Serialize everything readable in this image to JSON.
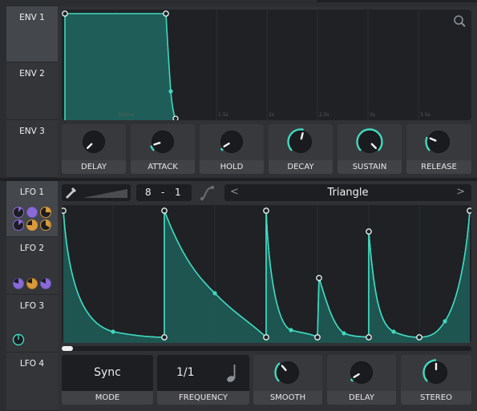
{
  "env_tabs": [
    "ENV 1",
    "ENV 2",
    "ENV 3"
  ],
  "lfo_tabs": [
    "LFO 1",
    "LFO 2",
    "LFO 3",
    "LFO 4"
  ],
  "env": {
    "time_ticks": [
      "500ms",
      "1.5s",
      "2s",
      "2.5s",
      "3s",
      "3.5s"
    ],
    "knobs": [
      {
        "label": "DELAY",
        "value": 0.0
      },
      {
        "label": "ATTACK",
        "value": 0.1
      },
      {
        "label": "HOLD",
        "value": 0.05
      },
      {
        "label": "DECAY",
        "value": 0.55
      },
      {
        "label": "SUSTAIN",
        "value": 1.0
      },
      {
        "label": "RELEASE",
        "value": 0.25
      }
    ]
  },
  "lfo": {
    "grid_x": "8",
    "grid_sep": "-",
    "grid_y": "1",
    "shape_name": "Triangle",
    "prev_symbol": "<",
    "next_symbol": ">",
    "mode_value": "Sync",
    "mode_label": "MODE",
    "frequency_value": "1/1",
    "frequency_label": "FREQUENCY",
    "knobs": [
      {
        "label": "SMOOTH",
        "value": 0.35
      },
      {
        "label": "DELAY",
        "value": 0.05
      },
      {
        "label": "STEREO",
        "value": 0.5
      }
    ]
  },
  "colors": {
    "accent": "#3fd8bf",
    "fill": "#1f5e58",
    "lfo_purple": "#8a6ad8",
    "lfo_orange": "#d89a3a"
  },
  "icons": {
    "search": "search-icon",
    "pencil": "pencil-icon",
    "curve": "curve-icon",
    "note": "quarter-note-icon"
  }
}
